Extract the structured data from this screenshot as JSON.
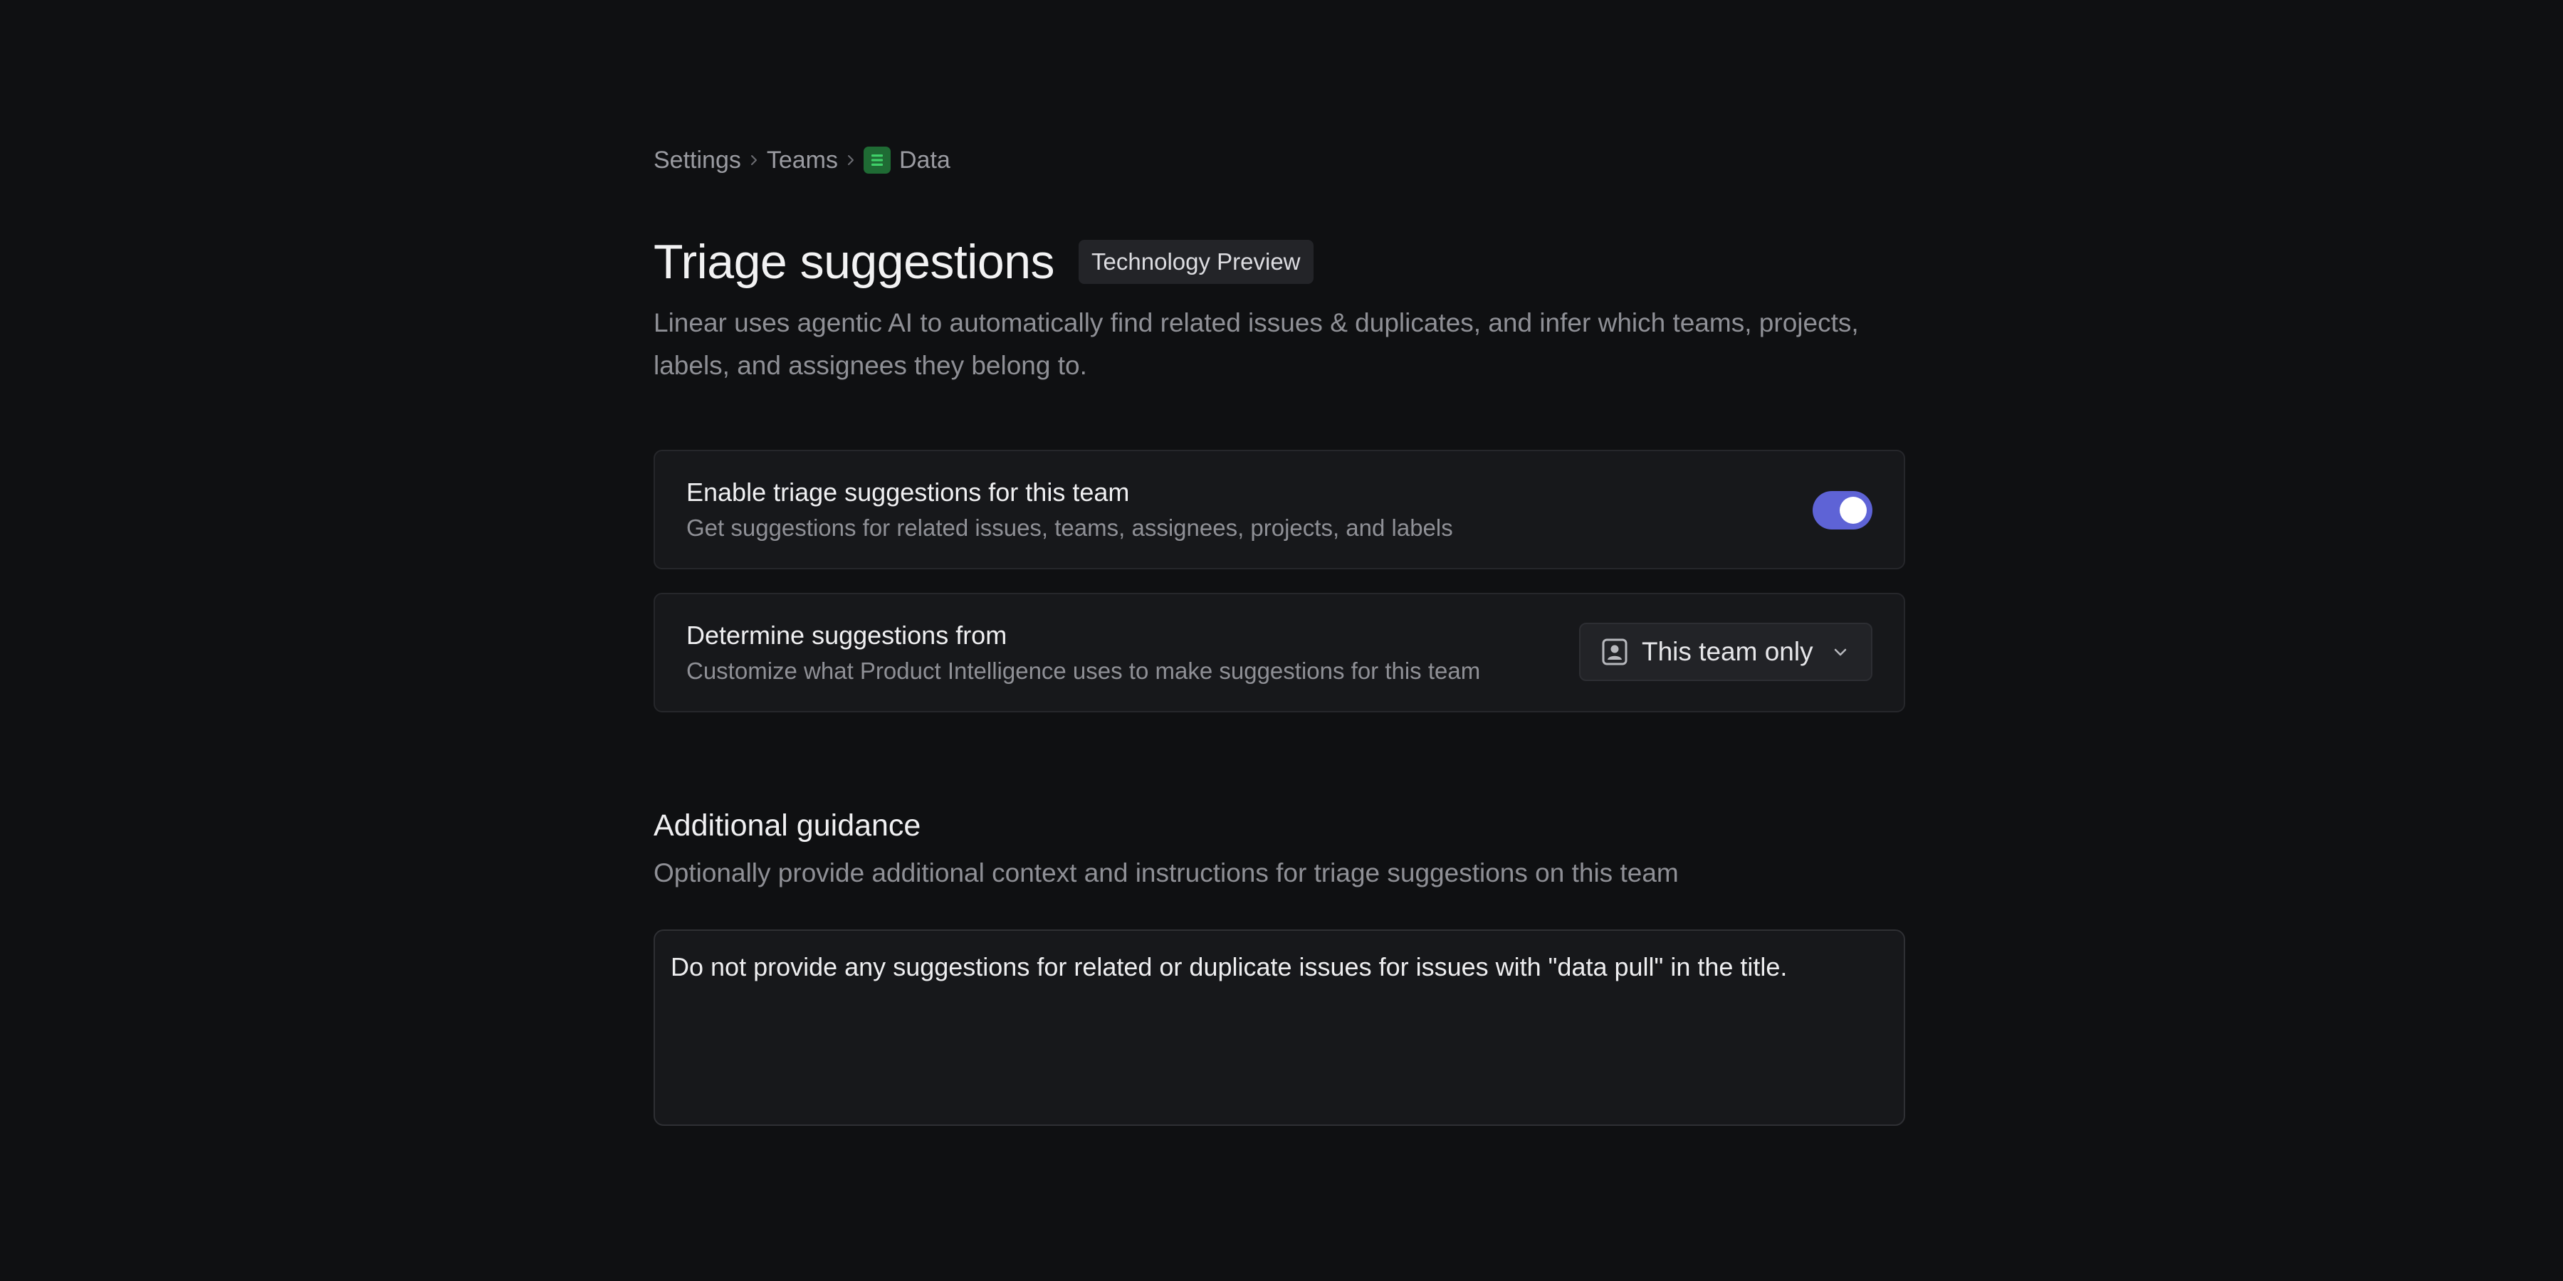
{
  "breadcrumb": {
    "items": [
      "Settings",
      "Teams",
      "Data"
    ],
    "team_icon": "team-list-icon",
    "team_color": "#1f6b34"
  },
  "header": {
    "title": "Triage suggestions",
    "badge": "Technology Preview",
    "description": "Linear uses agentic AI to automatically find related issues & duplicates, and infer which teams, projects, labels, and assignees they belong to."
  },
  "settings": {
    "enable": {
      "label": "Enable triage suggestions for this team",
      "sublabel": "Get suggestions for related issues, teams, assignees, projects, and labels",
      "enabled": true,
      "accent": "#5e63d6"
    },
    "source": {
      "label": "Determine suggestions from",
      "sublabel": "Customize what Product Intelligence uses to make suggestions for this team",
      "selected": "This team only",
      "icon": "person-badge-icon"
    }
  },
  "guidance": {
    "title": "Additional guidance",
    "subtitle": "Optionally provide additional context and instructions for triage suggestions on this team",
    "value": "Do not provide any suggestions for related or duplicate issues for issues with \"data pull\" in the title."
  }
}
